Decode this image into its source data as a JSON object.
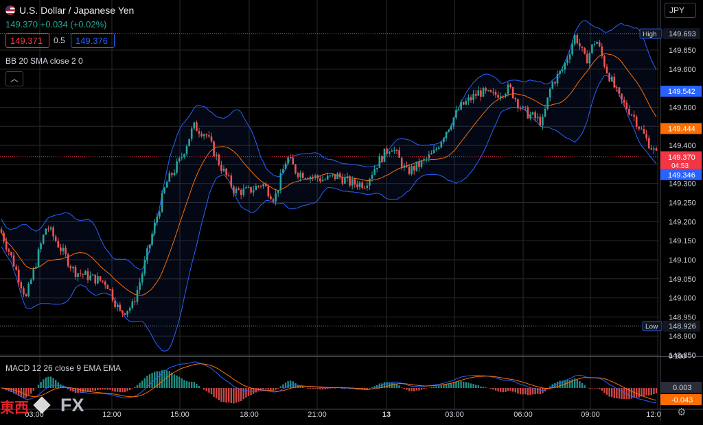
{
  "header": {
    "title": "U.S. Dollar / Japanese Yen",
    "last": "149.370",
    "change": "+0.034 (+0.02%)",
    "bid": "149.371",
    "spread": "0.5",
    "ask": "149.376",
    "indicator": "BB 20 SMA close 2 0",
    "currency_button": "JPY",
    "macd_label": "MACD 12 26 close 9 EMA EMA",
    "collapse_icon": "chevron-up-icon",
    "settings_icon": "gear-icon"
  },
  "logo": {
    "kanji": "東西",
    "fx": "FX"
  },
  "colors": {
    "up": "#26a69a",
    "down": "#ef5350",
    "band": "#2962ff",
    "basis": "#ff6d00",
    "background": "#000000"
  },
  "chart_data": {
    "type": "candlestick",
    "xlabels": [
      "03:00",
      "12:00",
      "15:00",
      "18:00",
      "21:00",
      "13",
      "03:00",
      "06:00",
      "09:00",
      "12:0"
    ],
    "yticks": [
      148.85,
      148.9,
      148.95,
      149.0,
      149.05,
      149.1,
      149.15,
      149.2,
      149.25,
      149.3,
      149.35,
      149.4,
      149.45,
      149.5,
      149.55,
      149.6,
      149.65
    ],
    "ylabels": [
      "148.850",
      "148.900",
      "148.950",
      "149.000",
      "149.050",
      "149.100",
      "149.150",
      "149.200",
      "149.250",
      "149.300",
      "",
      "149.400",
      "149.450",
      "149.500",
      "",
      "149.600",
      "149.650"
    ],
    "ylim": [
      148.85,
      149.73
    ],
    "high": {
      "label": "High",
      "value": 149.693,
      "text": "149.693"
    },
    "low": {
      "label": "Low",
      "value": 148.926,
      "text": "148.926"
    },
    "price_tags": [
      {
        "value": 149.542,
        "text": "149.542",
        "color": "#2962ff"
      },
      {
        "value": 149.444,
        "text": "149.444",
        "color": "#ff6d00"
      },
      {
        "value": 149.37,
        "text": "149.370",
        "sub": "04:53",
        "color": "#f23645"
      },
      {
        "value": 149.346,
        "text": "149.346",
        "color": "#2962ff"
      }
    ],
    "macd_tags": [
      {
        "text": "0.003",
        "color": "#2a2e39"
      },
      {
        "text": "-0.043",
        "color": "#ff6d00"
      }
    ],
    "macd_top_tick": "0.100",
    "anchors": [
      [
        0,
        149.18
      ],
      [
        18,
        149.1
      ],
      [
        38,
        149.0
      ],
      [
        58,
        149.13
      ],
      [
        68,
        149.19
      ],
      [
        88,
        149.13
      ],
      [
        108,
        149.07
      ],
      [
        138,
        149.05
      ],
      [
        155,
        149.04
      ],
      [
        175,
        148.96
      ],
      [
        193,
        148.98
      ],
      [
        205,
        149.05
      ],
      [
        222,
        149.17
      ],
      [
        242,
        149.3
      ],
      [
        262,
        149.36
      ],
      [
        282,
        149.45
      ],
      [
        300,
        149.43
      ],
      [
        320,
        149.35
      ],
      [
        342,
        149.28
      ],
      [
        362,
        149.28
      ],
      [
        382,
        149.3
      ],
      [
        400,
        149.26
      ],
      [
        418,
        149.37
      ],
      [
        432,
        149.33
      ],
      [
        452,
        149.32
      ],
      [
        472,
        149.31
      ],
      [
        492,
        149.32
      ],
      [
        512,
        149.3
      ],
      [
        532,
        149.3
      ],
      [
        552,
        149.36
      ],
      [
        570,
        149.4
      ],
      [
        592,
        149.33
      ],
      [
        612,
        149.35
      ],
      [
        632,
        149.38
      ],
      [
        650,
        149.44
      ],
      [
        670,
        149.5
      ],
      [
        698,
        149.54
      ],
      [
        718,
        149.53
      ],
      [
        742,
        149.55
      ],
      [
        762,
        149.49
      ],
      [
        790,
        149.46
      ],
      [
        803,
        149.56
      ],
      [
        820,
        149.6
      ],
      [
        838,
        149.69
      ],
      [
        853,
        149.62
      ],
      [
        868,
        149.68
      ],
      [
        883,
        149.6
      ],
      [
        903,
        149.52
      ],
      [
        922,
        149.48
      ],
      [
        940,
        149.42
      ],
      [
        958,
        149.37
      ]
    ],
    "bb_note": "Bollinger Bands 20 SMA close 2"
  }
}
